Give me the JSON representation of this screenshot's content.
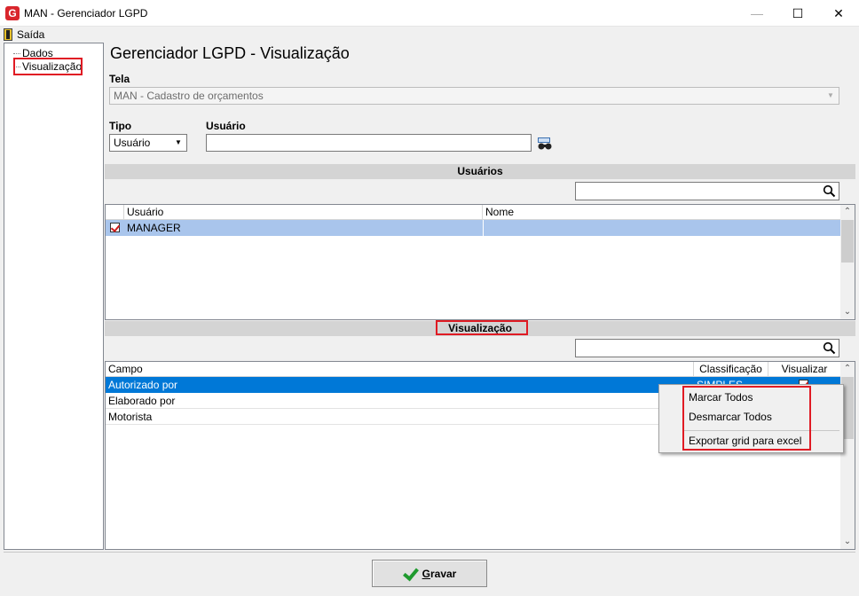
{
  "window": {
    "title": "MAN - Gerenciador LGPD"
  },
  "menu": {
    "exit_label": "Saída"
  },
  "tree": {
    "items": [
      "Dados",
      "Visualização"
    ]
  },
  "page_title": "Gerenciador LGPD - Visualização",
  "tela": {
    "label": "Tela",
    "value": "MAN - Cadastro de orçamentos"
  },
  "tipo": {
    "label": "Tipo",
    "value": "Usuário"
  },
  "usuario": {
    "label": "Usuário",
    "value": ""
  },
  "usuarios_section": {
    "title": "Usuários",
    "search_value": "",
    "columns": [
      "Usuário",
      "Nome"
    ],
    "rows": [
      {
        "usuario": "MANAGER",
        "nome": "",
        "checked": true
      }
    ]
  },
  "visualizacao_section": {
    "title": "Visualização",
    "search_value": "",
    "columns": [
      "Campo",
      "Classificação",
      "Visualizar"
    ],
    "rows": [
      {
        "campo": "Autorizado por",
        "classificacao": "SIMPLES",
        "visualizar": true
      },
      {
        "campo": "Elaborado por",
        "classificacao": "",
        "visualizar": false
      },
      {
        "campo": "Motorista",
        "classificacao": "",
        "visualizar": false
      }
    ]
  },
  "context_menu": {
    "items": [
      "Marcar Todos",
      "Desmarcar Todos",
      "Exportar grid para excel"
    ]
  },
  "save_button": {
    "label_first": "G",
    "label_rest": "ravar"
  },
  "colors": {
    "accent_red": "#e01b24",
    "selection_blue": "#0078d7",
    "selection_light": "#a9c5ec",
    "save_check_green": "#1f9a2e"
  }
}
